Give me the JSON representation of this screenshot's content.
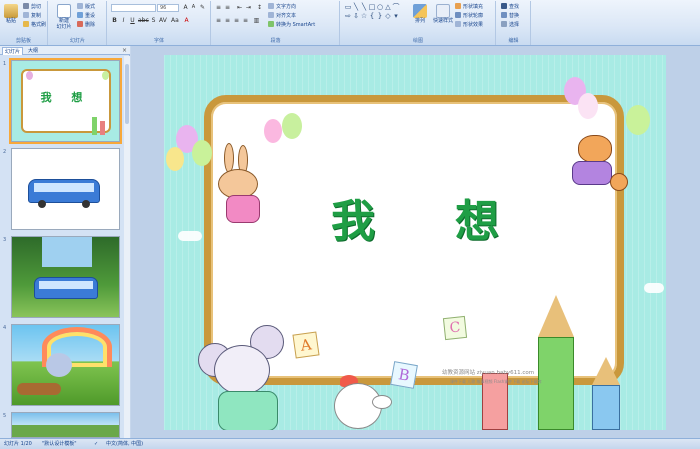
{
  "ribbon": {
    "clipboard": {
      "label": "剪贴板",
      "paste": "粘贴",
      "cut": "剪切",
      "copy": "复制",
      "format_painter": "格式刷"
    },
    "slides": {
      "label": "幻灯片",
      "new_slide": "新建",
      "new_slide_2": "幻灯片",
      "layout": "版式",
      "reset": "重设",
      "delete": "删除"
    },
    "font": {
      "label": "字体",
      "font_size": "96"
    },
    "paragraph": {
      "label": "段落",
      "text_direction": "文字方向",
      "align_text": "对齐文本",
      "convert_smartart": "转换为 SmartArt"
    },
    "drawing": {
      "label": "绘图",
      "arrange": "排列",
      "quick_styles": "快速样式",
      "shape_fill": "形状填充",
      "shape_outline": "形状轮廓",
      "shape_effects": "形状效果"
    },
    "editing": {
      "label": "编辑",
      "find": "查找",
      "replace": "替换",
      "select": "选择"
    }
  },
  "left_pane": {
    "tab_slides": "幻灯片",
    "tab_outline": "大纲",
    "close": "×",
    "thumbnails": [
      {
        "number": "1",
        "title": "我  想"
      },
      {
        "number": "2"
      },
      {
        "number": "3"
      },
      {
        "number": "4"
      },
      {
        "number": "5"
      }
    ]
  },
  "slide": {
    "title": "我想",
    "watermark_line1": "幼教资源网站 ziyuan.baby611.com",
    "watermark_line2": "课件下载   儿歌   故事视频   Flash课件下载   论坛下载库",
    "letters": [
      "A",
      "B",
      "C"
    ]
  },
  "status_bar": {
    "slide_info": "幻灯片 1/20",
    "theme": "\"默认设计模板\"",
    "language": "中文(简体, 中国)"
  },
  "colors": {
    "title_green": "#1f9e45",
    "slide_bg": "#a8ebe4",
    "frame_brown": "#c9983c",
    "selection_orange": "#f7a83a"
  }
}
